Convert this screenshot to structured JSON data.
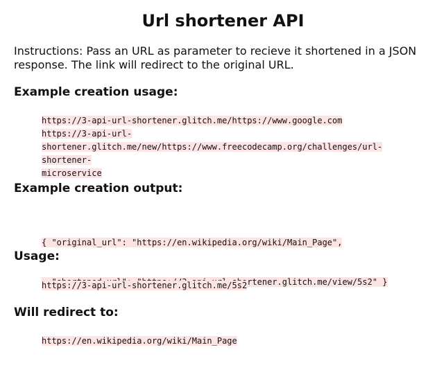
{
  "title": "Url shortener API",
  "instructions": "Instructions: Pass an URL as parameter to recieve it shortened in a JSON response. The link will redirect to the original URL.",
  "sections": {
    "creation": {
      "heading": "Example creation usage:",
      "lines": [
        "https://3-api-url-shortener.glitch.me/https://www.google.com",
        "https://3-api-url-",
        "shortener.glitch.me/new/https://www.freecodecamp.org/challenges/url-shortener-",
        "microservice"
      ]
    },
    "output": {
      "heading": "Example creation output:",
      "lines": [
        "{ \"original_url\": \"https://en.wikipedia.org/wiki/Main_Page\",",
        "  \"shortened_url\": \"https://3-api-url-shortener.glitch.me/view/5s2\" }"
      ]
    },
    "usage": {
      "heading": "Usage:",
      "lines": [
        "https://3-api-url-shortener.glitch.me/5s2"
      ]
    },
    "redirect": {
      "heading": "Will redirect to:",
      "lines": [
        "https://en.wikipedia.org/wiki/Main_Page"
      ]
    }
  },
  "colors": {
    "code_background": "#fde4e4",
    "text": "#111111",
    "page_background": "#ffffff"
  }
}
